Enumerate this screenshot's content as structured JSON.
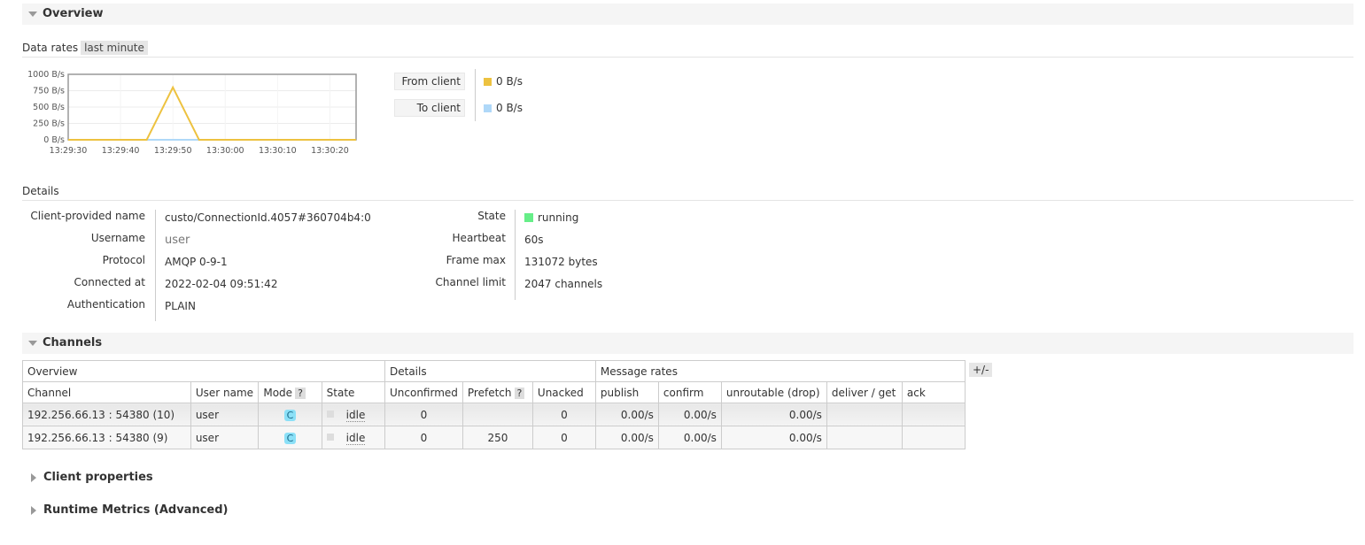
{
  "overview": {
    "title": "Overview"
  },
  "data_rates": {
    "label": "Data rates",
    "range": "last minute"
  },
  "chart_data": {
    "type": "line",
    "x": [
      "13:29:30",
      "13:29:35",
      "13:29:40",
      "13:29:45",
      "13:29:50",
      "13:29:55",
      "13:30:00",
      "13:30:05",
      "13:30:10",
      "13:30:15",
      "13:30:20",
      "13:30:25"
    ],
    "x_ticks": [
      "13:29:30",
      "13:29:40",
      "13:29:50",
      "13:30:00",
      "13:30:10",
      "13:30:20"
    ],
    "y_ticks": [
      "1000 B/s",
      "750 B/s",
      "500 B/s",
      "250 B/s",
      "0 B/s"
    ],
    "ylim": [
      0,
      1000
    ],
    "grid": true,
    "series": [
      {
        "name": "From client",
        "color": "#edc240",
        "values": [
          0,
          0,
          0,
          0,
          800,
          0,
          0,
          0,
          0,
          0,
          0,
          0
        ]
      },
      {
        "name": "To client",
        "color": "#afd8f8",
        "values": [
          0,
          0,
          0,
          0,
          0,
          0,
          0,
          0,
          0,
          0,
          0,
          0
        ]
      }
    ]
  },
  "legend": {
    "from_client": {
      "label": "From client",
      "value": "0 B/s",
      "color": "#edc240"
    },
    "to_client": {
      "label": "To client",
      "value": "0 B/s",
      "color": "#afd8f8"
    }
  },
  "details": {
    "title": "Details",
    "left": [
      {
        "label": "Client-provided name",
        "value": "custo/ConnectionId.4057#360704b4:0"
      },
      {
        "label": "Username",
        "value": "user"
      },
      {
        "label": "Protocol",
        "value": "AMQP 0-9-1"
      },
      {
        "label": "Connected at",
        "value": "2022-02-04 09:51:42"
      },
      {
        "label": "Authentication",
        "value": "PLAIN"
      }
    ],
    "right": [
      {
        "label": "State",
        "value": "running",
        "color": "#66ee88"
      },
      {
        "label": "Heartbeat",
        "value": "60s"
      },
      {
        "label": "Frame max",
        "value": "131072 bytes"
      },
      {
        "label": "Channel limit",
        "value": "2047 channels"
      }
    ]
  },
  "channels": {
    "title": "Channels",
    "toggle": "+/-",
    "groups": [
      "Overview",
      "Details",
      "Message rates"
    ],
    "columns": [
      "Channel",
      "User name",
      "Mode",
      "State",
      "Unconfirmed",
      "Prefetch",
      "Unacked",
      "publish",
      "confirm",
      "unroutable (drop)",
      "deliver / get",
      "ack"
    ],
    "help": "?",
    "rows": [
      {
        "channel": "192.256.66.13 : 54380  (10)",
        "user": "user",
        "mode": "C",
        "state": "idle",
        "unconfirmed": "0",
        "prefetch": "",
        "unacked": "0",
        "publish": "0.00/s",
        "confirm": "0.00/s",
        "unroutable": "0.00/s",
        "deliver": "",
        "ack": ""
      },
      {
        "channel": "192.256.66.13 : 54380  (9)",
        "user": "user",
        "mode": "C",
        "state": "idle",
        "unconfirmed": "0",
        "prefetch": "250",
        "unacked": "0",
        "publish": "0.00/s",
        "confirm": "0.00/s",
        "unroutable": "0.00/s",
        "deliver": "",
        "ack": ""
      }
    ]
  },
  "client_properties": {
    "title": "Client properties"
  },
  "runtime_metrics": {
    "title": "Runtime Metrics (Advanced)"
  }
}
